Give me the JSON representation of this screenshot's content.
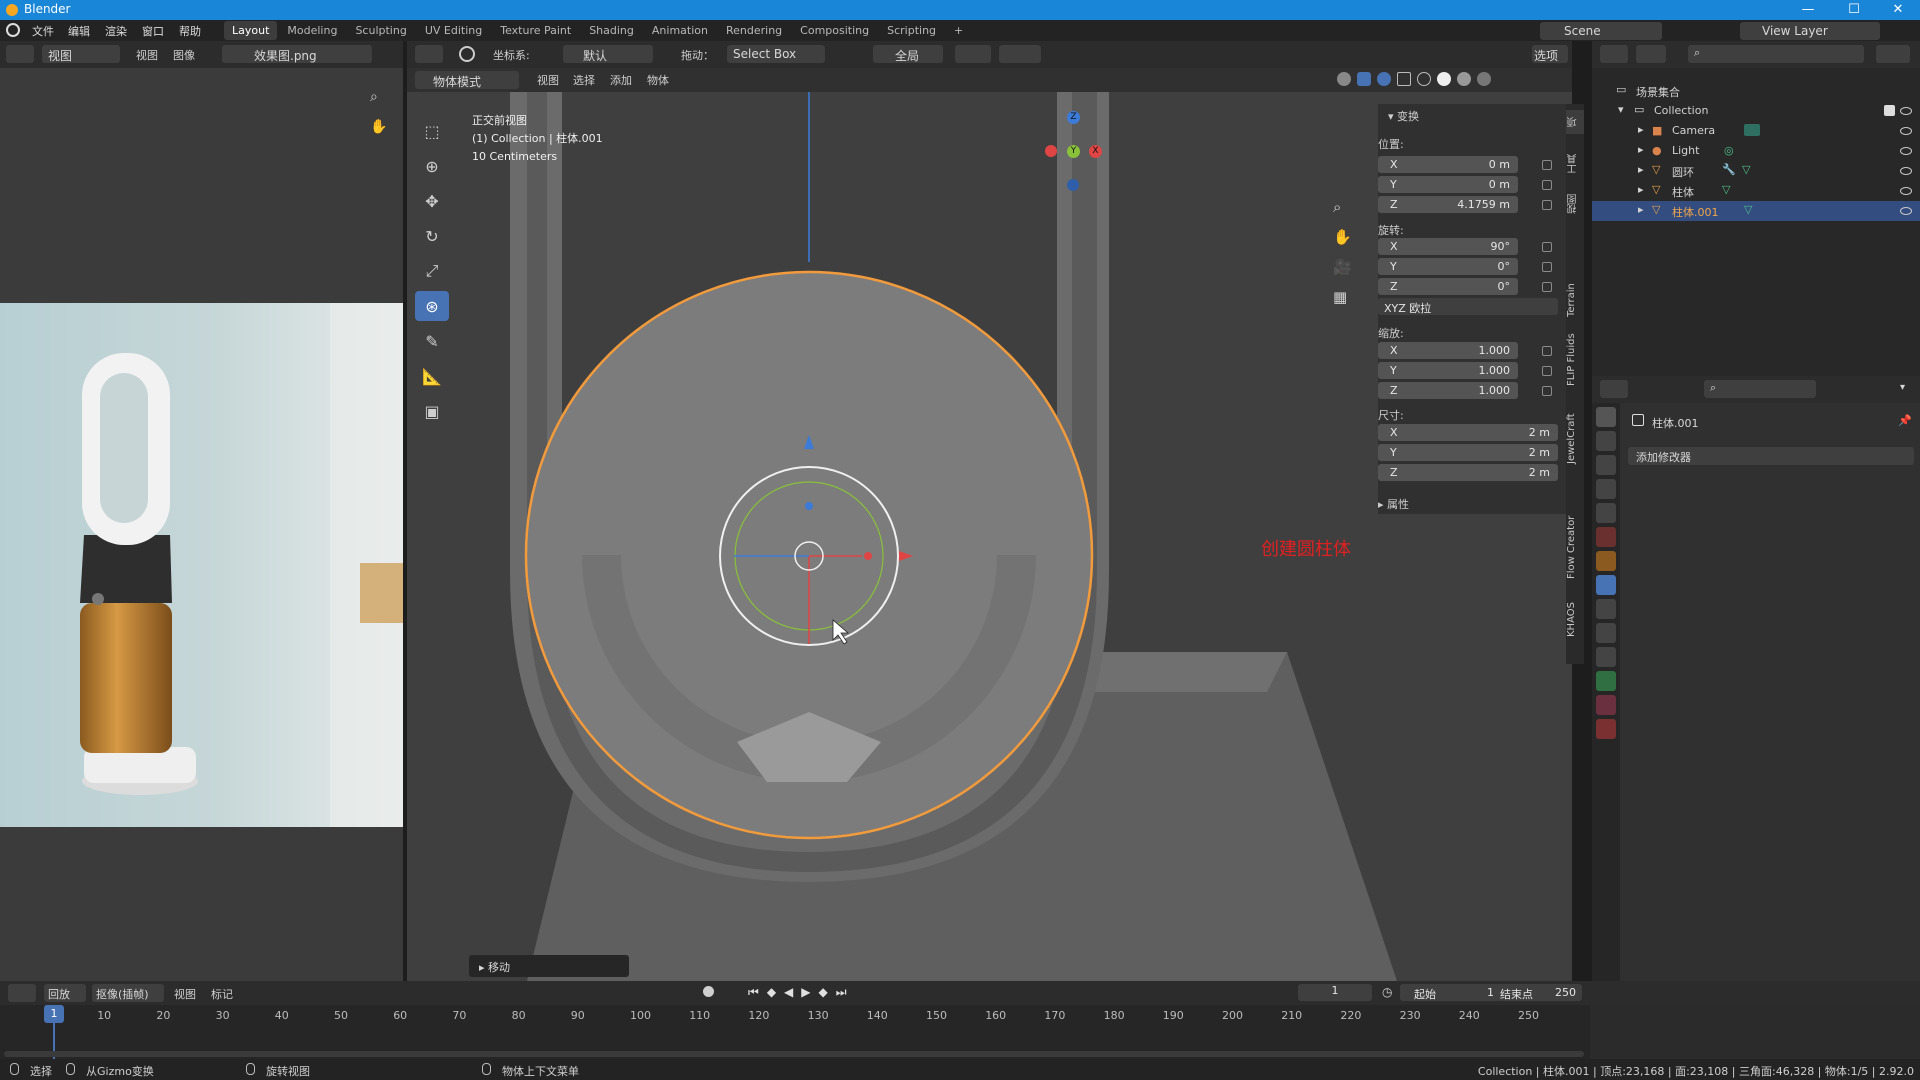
{
  "window": {
    "title": "Blender",
    "controls": [
      "—",
      "☐",
      "✕"
    ]
  },
  "menubar": {
    "items": [
      "文件",
      "编辑",
      "渲染",
      "窗口",
      "帮助"
    ],
    "workspaces": [
      "Layout",
      "Modeling",
      "Sculpting",
      "UV Editing",
      "Texture Paint",
      "Shading",
      "Animation",
      "Rendering",
      "Compositing",
      "Scripting"
    ],
    "active_workspace": "Layout",
    "add_tab": "+",
    "scene": "Scene",
    "view_layer": "View Layer"
  },
  "image_editor": {
    "header": [
      "视图",
      "视图",
      "图像"
    ],
    "image_name": "效果图.png"
  },
  "viewport": {
    "header": {
      "coord_label": "坐标系:",
      "coord_value": "默认",
      "drag_label": "拖动：",
      "drag_value": "Select Box",
      "pivot": "全局",
      "options": "选项"
    },
    "mode": "物体模式",
    "menus": [
      "视图",
      "选择",
      "添加",
      "物体"
    ],
    "overlay_lines": [
      "正交前视图",
      "(1) Collection | 柱体.001",
      "10 Centimeters"
    ],
    "annotation": "创建圆柱体",
    "last_op": "移动",
    "gizmo_axes": {
      "x": "X",
      "y": "Y",
      "z": "Z"
    }
  },
  "npanel": {
    "section": "变换",
    "location_label": "位置:",
    "location": [
      {
        "axis": "X",
        "value": "0 m"
      },
      {
        "axis": "Y",
        "value": "0 m"
      },
      {
        "axis": "Z",
        "value": "4.1759 m"
      }
    ],
    "rotation_label": "旋转:",
    "rotation": [
      {
        "axis": "X",
        "value": "90°"
      },
      {
        "axis": "Y",
        "value": "0°"
      },
      {
        "axis": "Z",
        "value": "0°"
      }
    ],
    "rotation_mode": "XYZ 欧拉",
    "scale_label": "缩放:",
    "scale": [
      {
        "axis": "X",
        "value": "1.000"
      },
      {
        "axis": "Y",
        "value": "1.000"
      },
      {
        "axis": "Z",
        "value": "1.000"
      }
    ],
    "dim_label": "尺寸:",
    "dimensions": [
      {
        "axis": "X",
        "value": "2 m"
      },
      {
        "axis": "Y",
        "value": "2 m"
      },
      {
        "axis": "Z",
        "value": "2 m"
      }
    ],
    "properties": "属性",
    "tabs": [
      "项",
      "工具",
      "视图",
      "Terrain",
      "FLIP Fluids",
      "JewelCraft",
      "Flow Creator",
      "KHAOS"
    ]
  },
  "outliner": {
    "root": "场景集合",
    "collection": "Collection",
    "items": [
      {
        "name": "Camera",
        "color": "#d9834d",
        "selected": false
      },
      {
        "name": "Light",
        "color": "#d9834d",
        "selected": false
      },
      {
        "name": "圆环",
        "color": "#e8a14c",
        "selected": false
      },
      {
        "name": "柱体",
        "color": "#e8a14c",
        "selected": false
      },
      {
        "name": "柱体.001",
        "color": "#e8a14c",
        "selected": true
      }
    ]
  },
  "properties": {
    "object_name": "柱体.001",
    "add_modifier": "添加修改器"
  },
  "timeline": {
    "menus": [
      "回放",
      "抠像(插帧)",
      "视图",
      "标记"
    ],
    "current_frame": "1",
    "start_label": "起始",
    "start": "1",
    "end_label": "结束点",
    "end": "250",
    "ticks": [
      "1",
      "10",
      "20",
      "30",
      "40",
      "50",
      "60",
      "70",
      "80",
      "90",
      "100",
      "110",
      "120",
      "130",
      "140",
      "150",
      "160",
      "170",
      "180",
      "190",
      "200",
      "210",
      "220",
      "230",
      "240",
      "250"
    ]
  },
  "statusbar": {
    "select": "选择",
    "gizmo": "从Gizmo变换",
    "rotate": "旋转视图",
    "context": "物体上下文菜单",
    "stats": "Collection | 柱体.001 | 顶点:23,168 | 面:23,108 | 三角面:46,328 | 物体:1/5 | 2.92.0"
  },
  "colors": {
    "accent": "#4772b3",
    "selection": "#f29b3d",
    "annotation": "#e02020",
    "x_axis": "#e04545",
    "y_axis": "#8ac13a",
    "z_axis": "#3c7bd8"
  }
}
